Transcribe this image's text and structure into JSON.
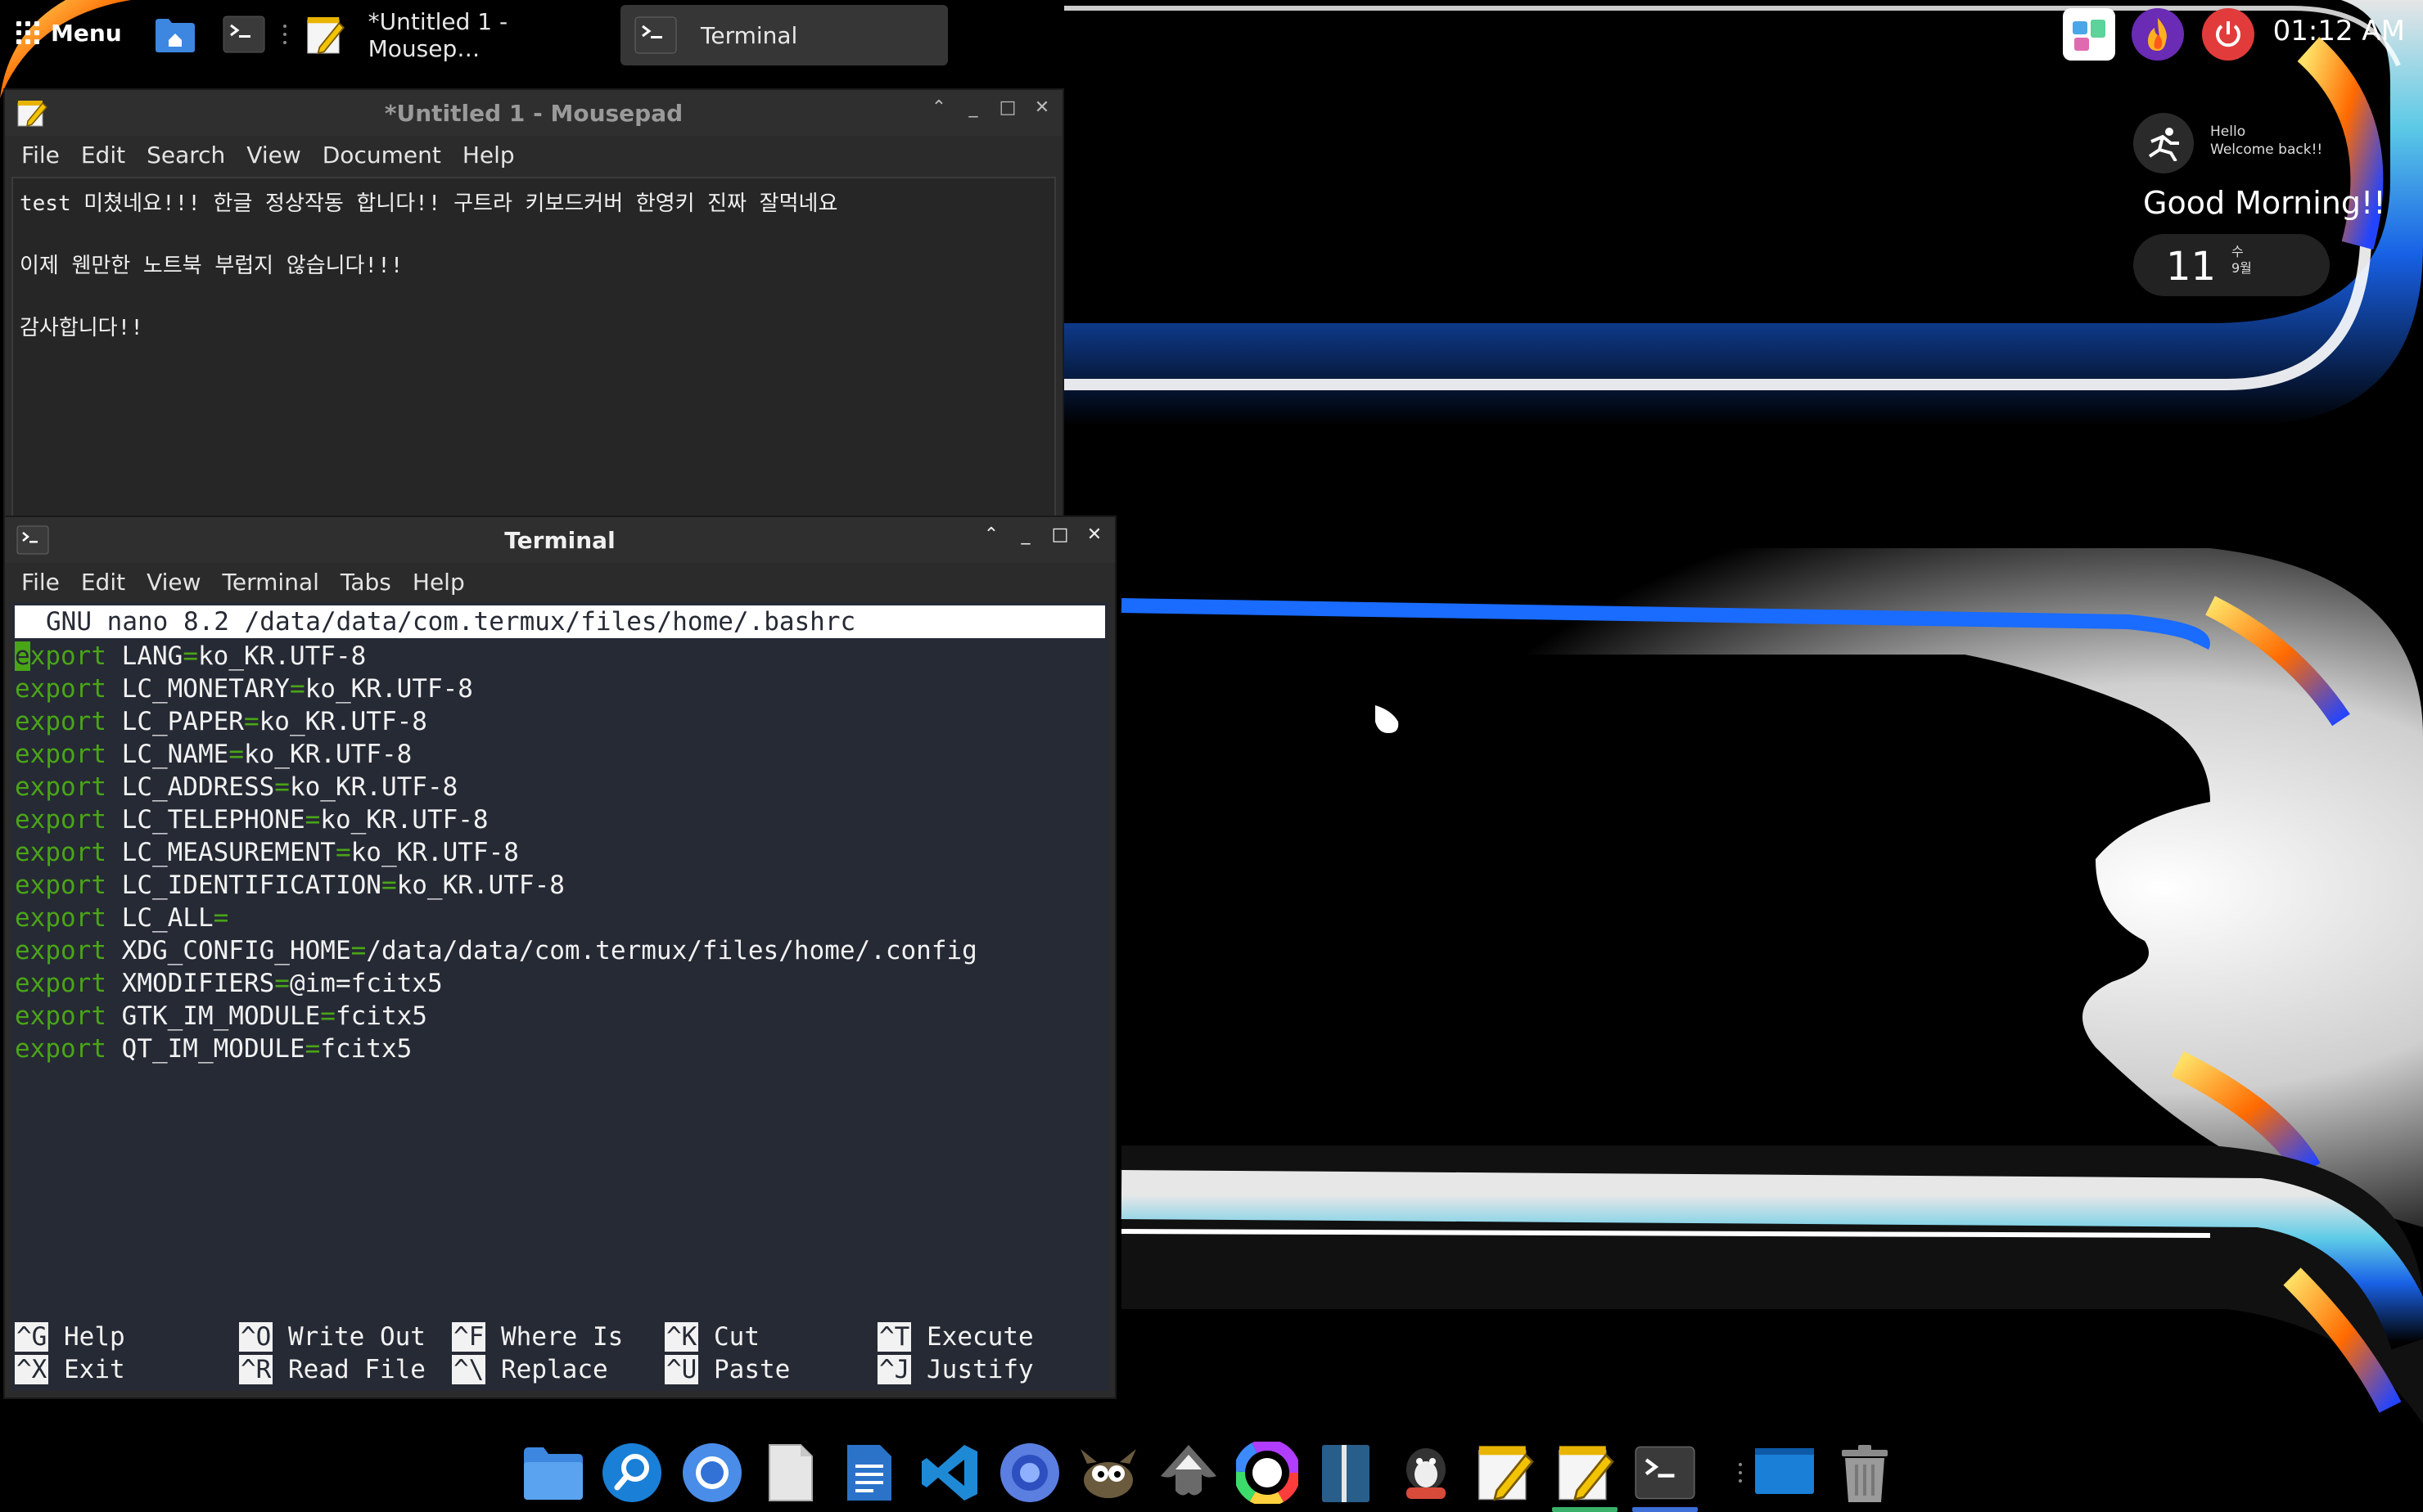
{
  "top_panel": {
    "menu_label": "Menu",
    "tasks": [
      {
        "label": "*Untitled 1 - Mousep…",
        "app": "mousepad"
      },
      {
        "label": "Terminal",
        "app": "terminal",
        "active": true
      }
    ],
    "clock": "01:12 AM"
  },
  "widget": {
    "hello_line1": "Hello",
    "hello_line2": "Welcome back!!",
    "greeting": "Good Morning!!",
    "day": "11",
    "weekday": "수",
    "month": "9월"
  },
  "mousepad": {
    "title": "*Untitled 1 - Mousepad",
    "menu": [
      "File",
      "Edit",
      "Search",
      "View",
      "Document",
      "Help"
    ],
    "lines": [
      "test 미쳤네요!!! 한글 정상작동 합니다!! 구트라 키보드커버 한영키 진짜 잘먹네요",
      "",
      "이제 웬만한 노트북 부럽지 않습니다!!!",
      "",
      "감사합니다!!"
    ]
  },
  "terminal": {
    "title": "Terminal",
    "menu": [
      "File",
      "Edit",
      "View",
      "Terminal",
      "Tabs",
      "Help"
    ],
    "nano_header": "GNU nano 8.2 /data/data/com.termux/files/home/.bashrc",
    "keyword": "export",
    "exports": [
      {
        "name": "LANG",
        "value": "ko_KR.UTF-8"
      },
      {
        "name": "LC_MONETARY",
        "value": "ko_KR.UTF-8"
      },
      {
        "name": "LC_PAPER",
        "value": "ko_KR.UTF-8"
      },
      {
        "name": "LC_NAME",
        "value": "ko_KR.UTF-8"
      },
      {
        "name": "LC_ADDRESS",
        "value": "ko_KR.UTF-8"
      },
      {
        "name": "LC_TELEPHONE",
        "value": "ko_KR.UTF-8"
      },
      {
        "name": "LC_MEASUREMENT",
        "value": "ko_KR.UTF-8"
      },
      {
        "name": "LC_IDENTIFICATION",
        "value": "ko_KR.UTF-8"
      },
      {
        "name": "LC_ALL",
        "value": ""
      },
      {
        "name": "XDG_CONFIG_HOME",
        "value": "/data/data/com.termux/files/home/.config"
      },
      {
        "name": "XMODIFIERS",
        "value": "@im=fcitx5"
      },
      {
        "name": "GTK_IM_MODULE",
        "value": "fcitx5"
      },
      {
        "name": "QT_IM_MODULE",
        "value": "fcitx5"
      }
    ],
    "shortcuts_row1": [
      {
        "key": "^G",
        "label": "Help"
      },
      {
        "key": "^O",
        "label": "Write Out"
      },
      {
        "key": "^F",
        "label": "Where Is"
      },
      {
        "key": "^K",
        "label": "Cut"
      },
      {
        "key": "^T",
        "label": "Execute"
      }
    ],
    "shortcuts_row2": [
      {
        "key": "^X",
        "label": "Exit"
      },
      {
        "key": "^R",
        "label": "Read File"
      },
      {
        "key": "^\\",
        "label": "Replace"
      },
      {
        "key": "^U",
        "label": "Paste"
      },
      {
        "key": "^J",
        "label": "Justify"
      }
    ]
  },
  "dock": {
    "items": [
      "file-manager-icon",
      "search-icon",
      "chromium-icon",
      "document-viewer-icon",
      "libreoffice-writer-icon",
      "vscode-icon",
      "browser-icon",
      "gimp-icon",
      "inkscape-icon",
      "color-picker-icon",
      "book-reader-icon",
      "game-icon",
      "mousepad-icon",
      "mousepad-running-icon",
      "terminal-icon",
      "desktop-icon",
      "trash-icon"
    ]
  },
  "colors": {
    "accent_green": "#4aa516",
    "terminal_bg": "#262a35",
    "window_bg": "#2b2b2b"
  }
}
